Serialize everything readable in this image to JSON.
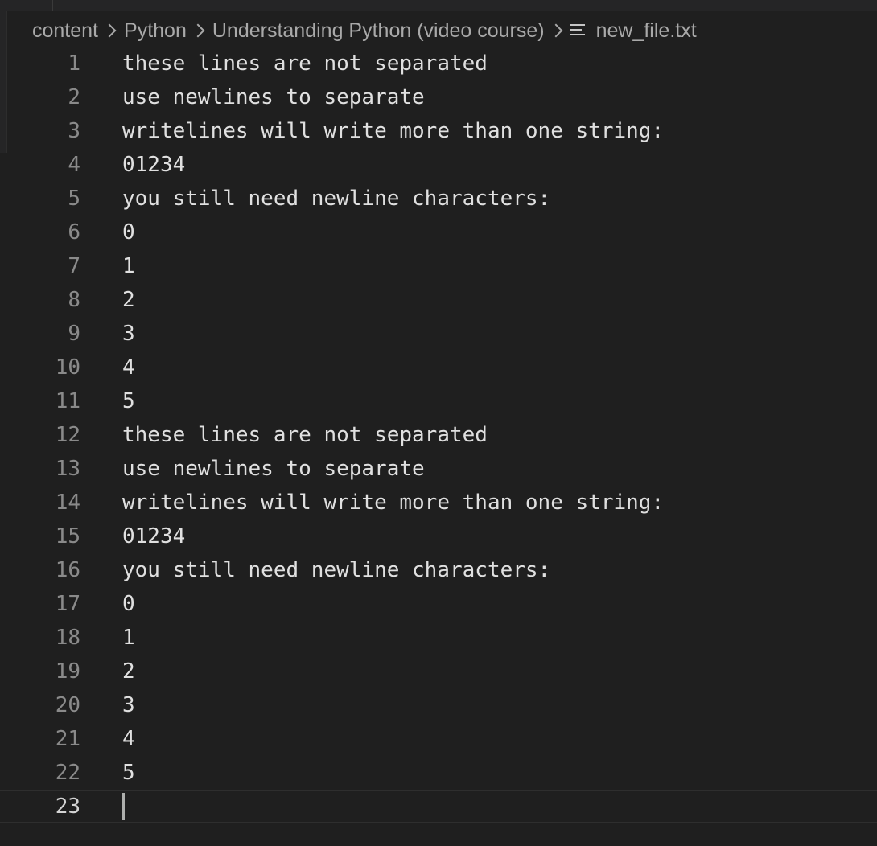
{
  "breadcrumb": {
    "items": [
      "content",
      "Python",
      "Understanding Python (video course)"
    ],
    "file_icon": "text-file-icon",
    "file_name": "new_file.txt"
  },
  "editor": {
    "current_line": 23,
    "lines": [
      {
        "num": "1",
        "text": "these lines are not separated"
      },
      {
        "num": "2",
        "text": "use newlines to separate"
      },
      {
        "num": "3",
        "text": "writelines will write more than one string:"
      },
      {
        "num": "4",
        "text": "01234"
      },
      {
        "num": "5",
        "text": "you still need newline characters:"
      },
      {
        "num": "6",
        "text": "0"
      },
      {
        "num": "7",
        "text": "1"
      },
      {
        "num": "8",
        "text": "2"
      },
      {
        "num": "9",
        "text": "3"
      },
      {
        "num": "10",
        "text": "4"
      },
      {
        "num": "11",
        "text": "5"
      },
      {
        "num": "12",
        "text": "these lines are not separated"
      },
      {
        "num": "13",
        "text": "use newlines to separate"
      },
      {
        "num": "14",
        "text": "writelines will write more than one string:"
      },
      {
        "num": "15",
        "text": "01234"
      },
      {
        "num": "16",
        "text": "you still need newline characters:"
      },
      {
        "num": "17",
        "text": "0"
      },
      {
        "num": "18",
        "text": "1"
      },
      {
        "num": "19",
        "text": "2"
      },
      {
        "num": "20",
        "text": "3"
      },
      {
        "num": "21",
        "text": "4"
      },
      {
        "num": "22",
        "text": "5"
      },
      {
        "num": "23",
        "text": ""
      }
    ]
  },
  "colors": {
    "background": "#1f1f1f",
    "text": "#e0e0e0",
    "line_number": "#8a8a8a",
    "breadcrumb": "#a9a9a9"
  }
}
